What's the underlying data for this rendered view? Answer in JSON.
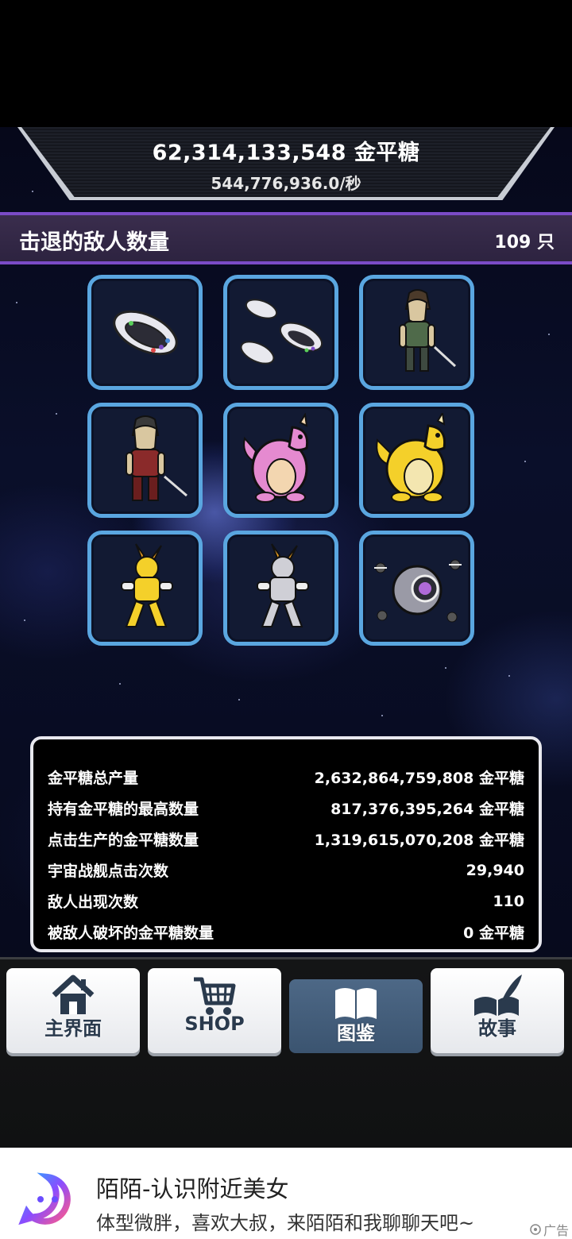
{
  "header": {
    "total_candy": "62,314,133,548 金平糖",
    "rate": "544,776,936.0/秒"
  },
  "section": {
    "title": "击退的敌人数量",
    "count": "109 只"
  },
  "enemies": [
    {
      "icon": "ufo-ship-icon"
    },
    {
      "icon": "ufo-fleet-icon"
    },
    {
      "icon": "predator-green-icon"
    },
    {
      "icon": "predator-red-icon"
    },
    {
      "icon": "pink-dragon-icon"
    },
    {
      "icon": "yellow-dragon-icon"
    },
    {
      "icon": "gold-robot-icon"
    },
    {
      "icon": "silver-robot-icon"
    },
    {
      "icon": "orb-station-icon"
    }
  ],
  "stats": [
    {
      "label": "金平糖总产量",
      "value": "2,632,864,759,808 金平糖"
    },
    {
      "label": "持有金平糖的最高数量",
      "value": "817,376,395,264 金平糖"
    },
    {
      "label": "点击生产的金平糖数量",
      "value": "1,319,615,070,208 金平糖"
    },
    {
      "label": "宇宙战舰点击次数",
      "value": "29,940"
    },
    {
      "label": "敌人出现次数",
      "value": "110"
    },
    {
      "label": "被敌人破坏的金平糖数量",
      "value": "0 金平糖"
    }
  ],
  "nav": [
    {
      "label": "主界面",
      "icon": "home-icon",
      "active": false
    },
    {
      "label": "SHOP",
      "icon": "cart-icon",
      "active": false
    },
    {
      "label": "图鉴",
      "icon": "book-icon",
      "active": true
    },
    {
      "label": "故事",
      "icon": "quill-icon",
      "active": false
    }
  ],
  "ad": {
    "title": "陌陌-认识附近美女",
    "description": "体型微胖，喜欢大叔，来陌陌和我聊聊天吧~",
    "tag": "广告"
  },
  "colors": {
    "section_border": "#7b4bc7",
    "card_border": "#5aa6e0",
    "nav_active": "#4d6886"
  }
}
